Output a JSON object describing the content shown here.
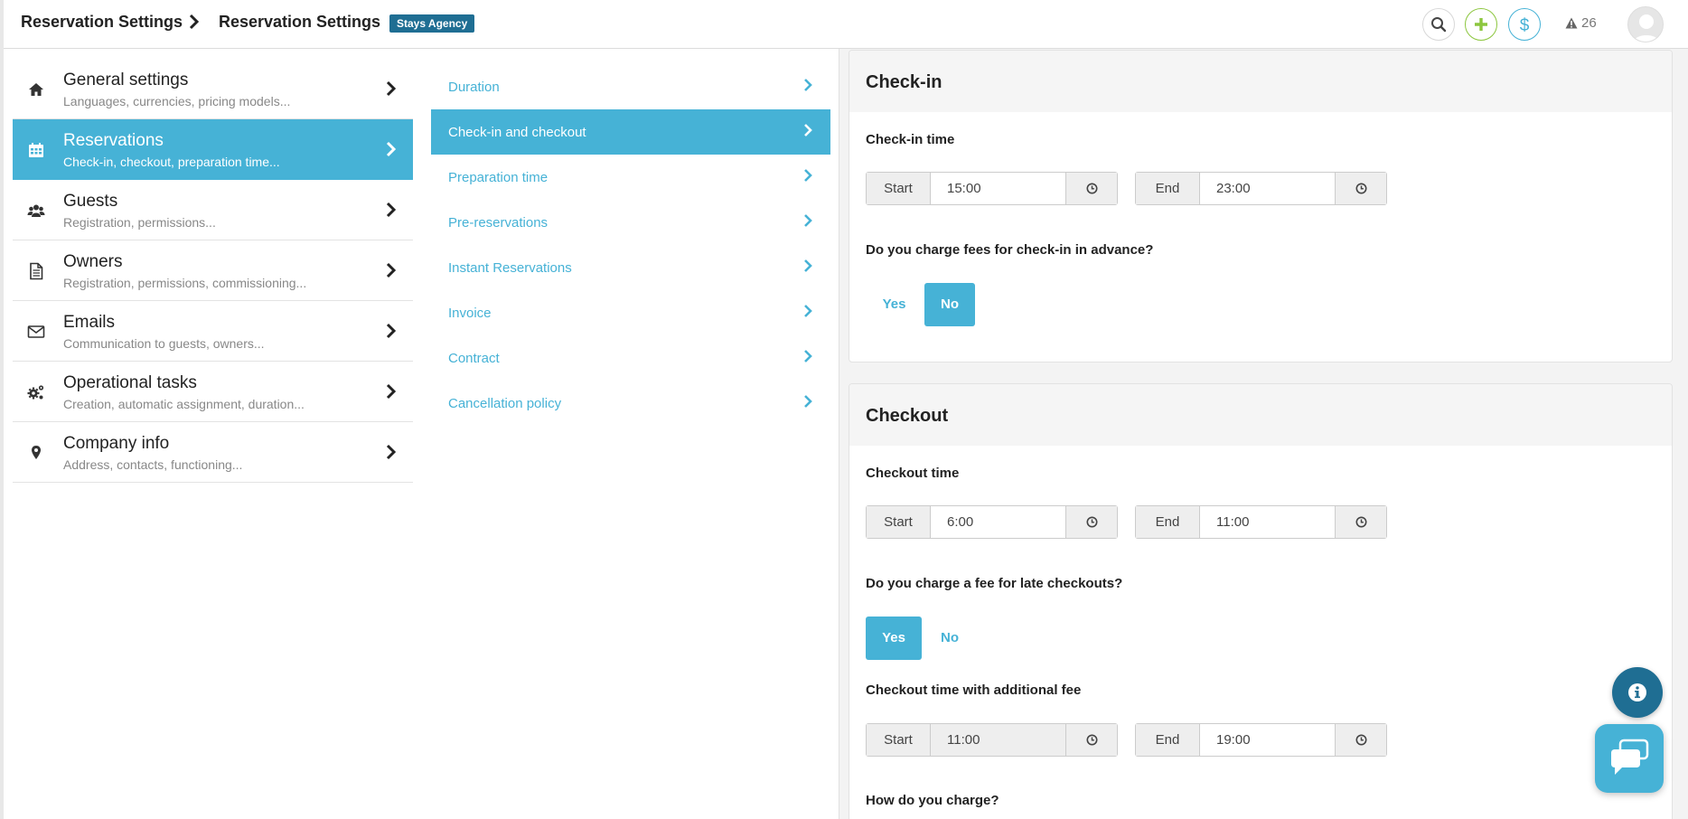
{
  "header": {
    "breadcrumb_1": "Reservation Settings",
    "breadcrumb_2": "Reservation Settings",
    "agency_badge": "Stays Agency",
    "alerts_count": "26",
    "icons": [
      "search-icon",
      "plus-icon",
      "dollar-icon",
      "warning-icon",
      "avatar"
    ]
  },
  "colors": {
    "accent": "#46b2d6",
    "badge": "#1f6e93",
    "plus": "#8cc63e"
  },
  "menu": {
    "items": [
      {
        "title": "General settings",
        "subtitle": "Languages, currencies, pricing models...",
        "icon": "home-icon"
      },
      {
        "title": "Reservations",
        "subtitle": "Check-in, checkout, preparation time...",
        "icon": "calendar-icon",
        "active": true
      },
      {
        "title": "Guests",
        "subtitle": "Registration, permissions...",
        "icon": "users-icon"
      },
      {
        "title": "Owners",
        "subtitle": "Registration, permissions, commissioning...",
        "icon": "document-icon"
      },
      {
        "title": "Emails",
        "subtitle": "Communication to guests, owners...",
        "icon": "envelope-icon"
      },
      {
        "title": "Operational tasks",
        "subtitle": "Creation, automatic assignment, duration...",
        "icon": "gears-icon"
      },
      {
        "title": "Company info",
        "subtitle": "Address, contacts, functioning...",
        "icon": "map-pin-icon"
      }
    ]
  },
  "submenu": {
    "items": [
      {
        "label": "Duration"
      },
      {
        "label": "Check-in and checkout",
        "active": true
      },
      {
        "label": "Preparation time"
      },
      {
        "label": "Pre-reservations"
      },
      {
        "label": "Instant Reservations"
      },
      {
        "label": "Invoice"
      },
      {
        "label": "Contract"
      },
      {
        "label": "Cancellation policy"
      }
    ]
  },
  "checkin": {
    "title": "Check-in",
    "time_label": "Check-in time",
    "start_prefix": "Start",
    "start_value": "15:00",
    "end_prefix": "End",
    "end_value": "23:00",
    "fee_question": "Do you charge fees for check-in in advance?",
    "yes_label": "Yes",
    "no_label": "No",
    "fee_selected": "No"
  },
  "checkout": {
    "title": "Checkout",
    "time_label": "Checkout time",
    "start_prefix": "Start",
    "start_value": "6:00",
    "end_prefix": "End",
    "end_value": "11:00",
    "late_question": "Do you charge a fee for late checkouts?",
    "yes_label": "Yes",
    "no_label": "No",
    "late_selected": "Yes",
    "additional_label": "Checkout time with additional fee",
    "add_start_prefix": "Start",
    "add_start_value": "11:00",
    "add_end_prefix": "End",
    "add_end_value": "19:00",
    "how_charge_label": "How do you charge?"
  }
}
